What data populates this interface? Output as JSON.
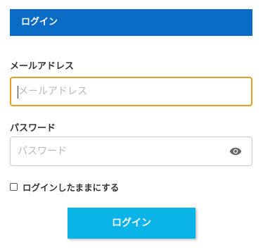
{
  "header": {
    "title": "ログイン",
    "background_color": "#0a6cc4"
  },
  "email": {
    "label": "メールアドレス",
    "placeholder": "メールアドレス",
    "value": "",
    "focused": true,
    "focus_color": "#e2a11a"
  },
  "password": {
    "label": "パスワード",
    "placeholder": "パスワード",
    "value": "",
    "toggle_icon": "eye-icon"
  },
  "remember": {
    "label": "ログインしたままにする",
    "checked": false
  },
  "submit": {
    "label": "ログイン",
    "background_color": "#0ab4e8"
  }
}
